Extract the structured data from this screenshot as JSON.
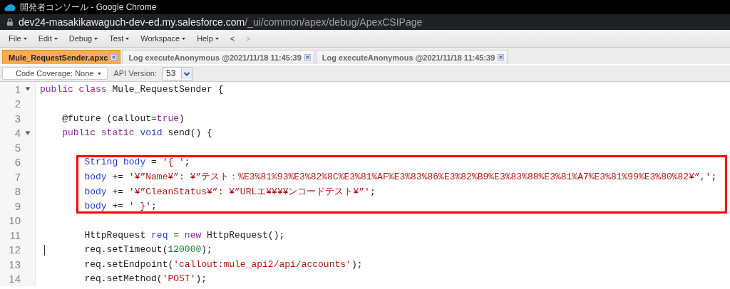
{
  "window": {
    "title": "開発者コンソール - Google Chrome"
  },
  "address_bar": {
    "host": "dev24-masakikawaguch-dev-ed.my.salesforce.com",
    "path": "/_ui/common/apex/debug/ApexCSIPage"
  },
  "menu": [
    {
      "label": "File",
      "kind": "menu",
      "disabled": false
    },
    {
      "label": "Edit",
      "kind": "menu",
      "disabled": false
    },
    {
      "label": "Debug",
      "kind": "menu",
      "disabled": false
    },
    {
      "label": "Test",
      "kind": "menu",
      "disabled": false
    },
    {
      "label": "Workspace",
      "kind": "menu",
      "disabled": false
    },
    {
      "label": "Help",
      "kind": "menu",
      "disabled": false
    },
    {
      "label": "<",
      "kind": "nav",
      "disabled": false
    },
    {
      "label": ">",
      "kind": "nav",
      "disabled": true
    }
  ],
  "tabs": [
    {
      "label": "Mule_RequestSender.apxc",
      "selected": true
    },
    {
      "label": "Log executeAnonymous @2021/11/18 11:45:39",
      "selected": false
    },
    {
      "label": "Log executeAnonymous @2021/11/18 11:45:39",
      "selected": false
    }
  ],
  "toolbar": {
    "coverage": "Code Coverage: None",
    "api_label": "API Version:",
    "api_value": "53"
  },
  "editor": {
    "lines": [
      {
        "number": "1",
        "fold": true,
        "cursor": false,
        "highlighted": false,
        "tokens": [
          {
            "kind": "keyword",
            "text": "public class "
          },
          {
            "kind": "plain",
            "text": "Mule_RequestSender {"
          }
        ]
      },
      {
        "number": "2",
        "fold": false,
        "cursor": false,
        "highlighted": false
      },
      {
        "number": "3",
        "fold": false,
        "cursor": false,
        "highlighted": false,
        "tokens": [
          {
            "kind": "plain",
            "text": "    @future (callout="
          },
          {
            "kind": "keyword",
            "text": "true"
          },
          {
            "kind": "plain",
            "text": ")"
          }
        ]
      },
      {
        "number": "4",
        "fold": true,
        "cursor": false,
        "highlighted": false,
        "tokens": [
          {
            "kind": "keyword",
            "text": "    public static "
          },
          {
            "kind": "type",
            "text": "void"
          },
          {
            "kind": "plain",
            "text": " send() {"
          }
        ]
      },
      {
        "number": "5",
        "fold": false,
        "cursor": false,
        "highlighted": false
      },
      {
        "number": "6",
        "fold": false,
        "cursor": false,
        "highlighted": true,
        "tokens": [
          {
            "kind": "type",
            "text": "        String body"
          },
          {
            "kind": "plain",
            "text": " = "
          },
          {
            "kind": "string",
            "text": "'{ '"
          },
          {
            "kind": "plain",
            "text": ";"
          }
        ]
      },
      {
        "number": "7",
        "fold": false,
        "cursor": false,
        "highlighted": true,
        "tokens": [
          {
            "kind": "type",
            "text": "        body"
          },
          {
            "kind": "plain",
            "text": " += "
          },
          {
            "kind": "string",
            "text": "'¥”Name¥”: ¥”テスト：%E3%81%93%E3%82%8C%E3%81%AF%E3%83%86%E3%82%B9%E3%83%88%E3%81%A7%E3%81%99%E3%80%82¥”,'"
          },
          {
            "kind": "plain",
            "text": ";"
          }
        ]
      },
      {
        "number": "8",
        "fold": false,
        "cursor": false,
        "highlighted": true,
        "tokens": [
          {
            "kind": "type",
            "text": "        body"
          },
          {
            "kind": "plain",
            "text": " += "
          },
          {
            "kind": "string",
            "text": "'¥”CleanStatus¥”: ¥”URLエ¥¥¥¥ンコードテスト¥”'"
          },
          {
            "kind": "plain",
            "text": ";"
          }
        ]
      },
      {
        "number": "9",
        "fold": false,
        "cursor": false,
        "highlighted": true,
        "tokens": [
          {
            "kind": "type",
            "text": "        body"
          },
          {
            "kind": "plain",
            "text": " += "
          },
          {
            "kind": "string",
            "text": "' }'"
          },
          {
            "kind": "plain",
            "text": ";"
          }
        ]
      },
      {
        "number": "10",
        "fold": false,
        "cursor": false,
        "highlighted": false
      },
      {
        "number": "11",
        "fold": false,
        "cursor": false,
        "highlighted": false,
        "tokens": [
          {
            "kind": "plain",
            "text": "        HttpRequest "
          },
          {
            "kind": "type",
            "text": "req"
          },
          {
            "kind": "plain",
            "text": " = "
          },
          {
            "kind": "keyword",
            "text": "new"
          },
          {
            "kind": "plain",
            "text": " HttpRequest();"
          }
        ]
      },
      {
        "number": "12",
        "fold": false,
        "cursor": true,
        "highlighted": false,
        "tokens": [
          {
            "kind": "plain",
            "text": "        req.setTimeout("
          },
          {
            "kind": "number",
            "text": "120000"
          },
          {
            "kind": "plain",
            "text": ");"
          }
        ]
      },
      {
        "number": "13",
        "fold": false,
        "cursor": false,
        "highlighted": false,
        "tokens": [
          {
            "kind": "plain",
            "text": "        req.setEndpoint("
          },
          {
            "kind": "string",
            "text": "'callout:mule_api2/api/accounts'"
          },
          {
            "kind": "plain",
            "text": ");"
          }
        ]
      },
      {
        "number": "14",
        "fold": false,
        "cursor": false,
        "highlighted": false,
        "tokens": [
          {
            "kind": "plain",
            "text": "        req.setMethod("
          },
          {
            "kind": "string",
            "text": "'POST'"
          },
          {
            "kind": "plain",
            "text": ");"
          }
        ]
      }
    ]
  }
}
